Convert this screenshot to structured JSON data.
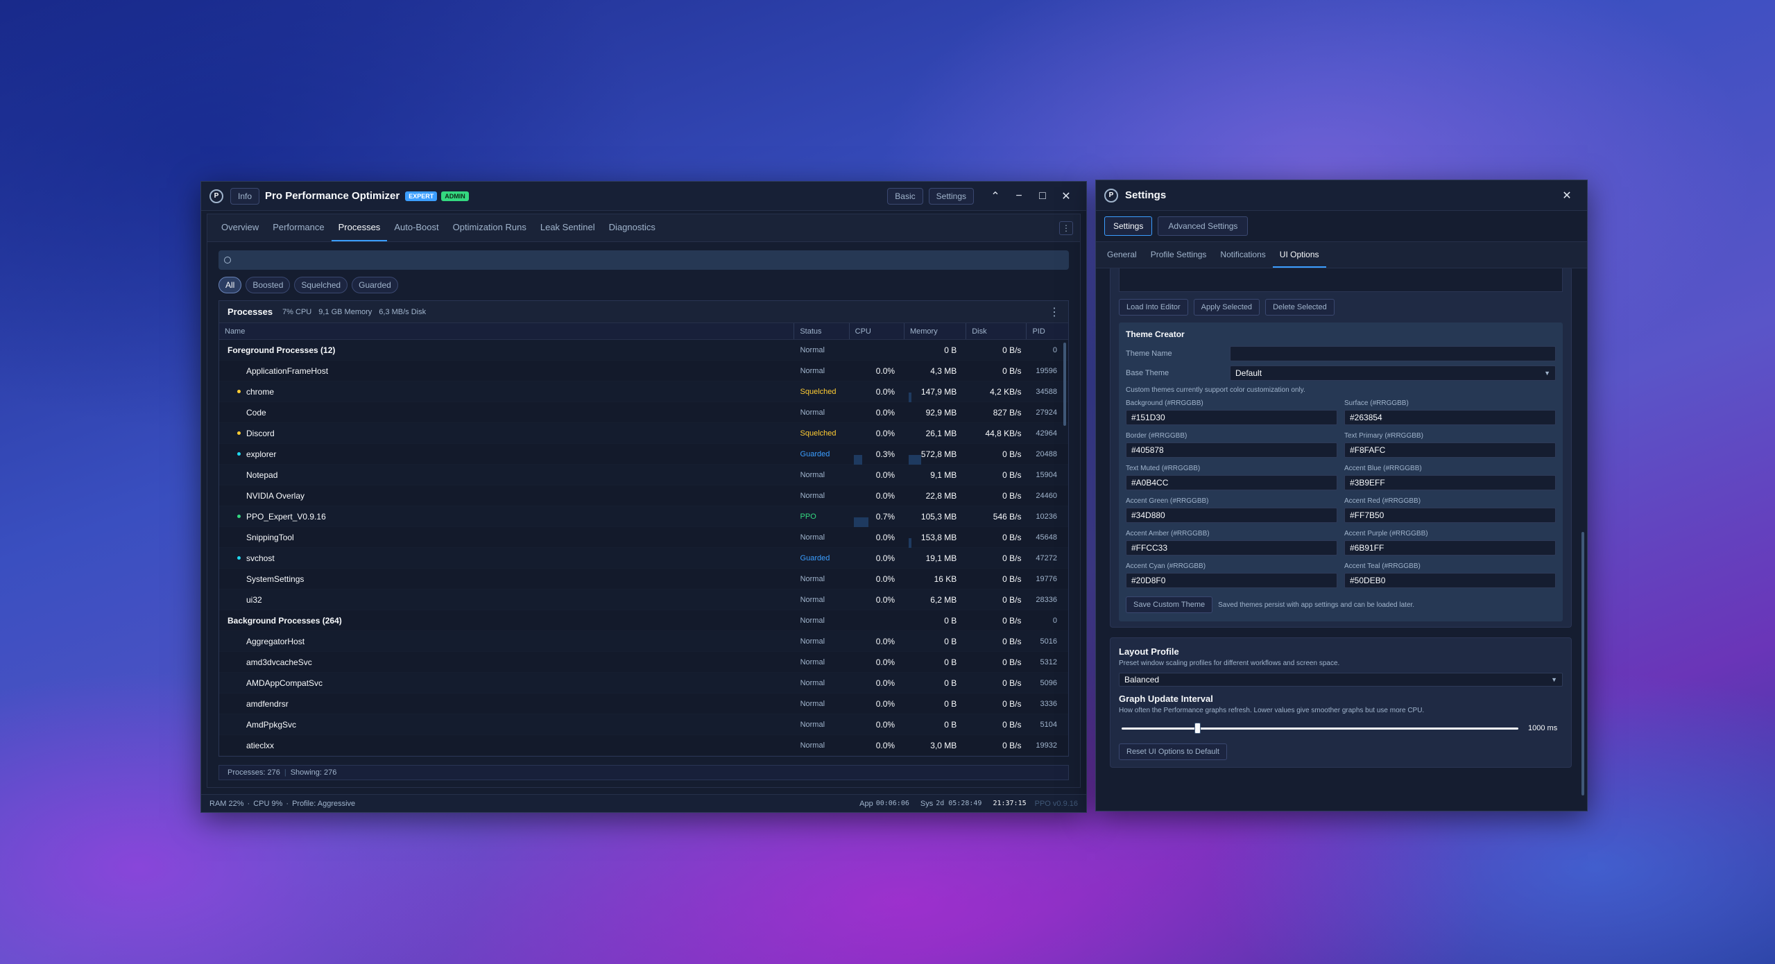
{
  "main": {
    "info_label": "Info",
    "title": "Pro Performance Optimizer",
    "badge_expert": "EXPERT",
    "badge_admin": "ADMIN",
    "basic_label": "Basic",
    "settings_label": "Settings",
    "tabs": [
      "Overview",
      "Performance",
      "Processes",
      "Auto-Boost",
      "Optimization Runs",
      "Leak Sentinel",
      "Diagnostics"
    ],
    "filters": [
      "All",
      "Boosted",
      "Squelched",
      "Guarded"
    ],
    "panel_title": "Processes",
    "stat_cpu": "7% CPU",
    "stat_mem": "9,1 GB Memory",
    "stat_disk": "6,3 MB/s Disk",
    "columns": [
      "Name",
      "Status",
      "CPU",
      "Memory",
      "Disk",
      "PID"
    ],
    "rows": [
      {
        "name": "Foreground Processes (12)",
        "status": "Normal",
        "cpu": "",
        "mem": "0 B",
        "disk": "0 B/s",
        "pid": "0",
        "group": true
      },
      {
        "name": "ApplicationFrameHost",
        "status": "Normal",
        "cpu": "0.0%",
        "mem": "4,3 MB",
        "disk": "0 B/s",
        "pid": "19596"
      },
      {
        "name": "chrome",
        "status": "Squelched",
        "cpu": "0.0%",
        "mem": "147,9 MB",
        "disk": "4,2 KB/s",
        "pid": "34588",
        "dot": "#FFCC33",
        "membar": 0.05
      },
      {
        "name": "Code",
        "status": "Normal",
        "cpu": "0.0%",
        "mem": "92,9 MB",
        "disk": "827 B/s",
        "pid": "27924"
      },
      {
        "name": "Discord",
        "status": "Squelched",
        "cpu": "0.0%",
        "mem": "26,1 MB",
        "disk": "44,8 KB/s",
        "pid": "42964",
        "dot": "#FFCC33"
      },
      {
        "name": "explorer",
        "status": "Guarded",
        "cpu": "0.3%",
        "mem": "572,8 MB",
        "disk": "0 B/s",
        "pid": "20488",
        "dot": "#20D8F0",
        "cpubar": 0.2,
        "membar": 0.25
      },
      {
        "name": "Notepad",
        "status": "Normal",
        "cpu": "0.0%",
        "mem": "9,1 MB",
        "disk": "0 B/s",
        "pid": "15904"
      },
      {
        "name": "NVIDIA Overlay",
        "status": "Normal",
        "cpu": "0.0%",
        "mem": "22,8 MB",
        "disk": "0 B/s",
        "pid": "24460"
      },
      {
        "name": "PPO_Expert_V0.9.16",
        "status": "PPO",
        "cpu": "0.7%",
        "mem": "105,3 MB",
        "disk": "546 B/s",
        "pid": "10236",
        "dot": "#34D880",
        "cpubar": 0.35
      },
      {
        "name": "SnippingTool",
        "status": "Normal",
        "cpu": "0.0%",
        "mem": "153,8 MB",
        "disk": "0 B/s",
        "pid": "45648",
        "membar": 0.05
      },
      {
        "name": "svchost",
        "status": "Guarded",
        "cpu": "0.0%",
        "mem": "19,1 MB",
        "disk": "0 B/s",
        "pid": "47272",
        "dot": "#20D8F0"
      },
      {
        "name": "SystemSettings",
        "status": "Normal",
        "cpu": "0.0%",
        "mem": "16 KB",
        "disk": "0 B/s",
        "pid": "19776"
      },
      {
        "name": "ui32",
        "status": "Normal",
        "cpu": "0.0%",
        "mem": "6,2 MB",
        "disk": "0 B/s",
        "pid": "28336"
      },
      {
        "name": "Background Processes (264)",
        "status": "Normal",
        "cpu": "",
        "mem": "0 B",
        "disk": "0 B/s",
        "pid": "0",
        "group": true
      },
      {
        "name": "AggregatorHost",
        "status": "Normal",
        "cpu": "0.0%",
        "mem": "0 B",
        "disk": "0 B/s",
        "pid": "5016"
      },
      {
        "name": "amd3dvcacheSvc",
        "status": "Normal",
        "cpu": "0.0%",
        "mem": "0 B",
        "disk": "0 B/s",
        "pid": "5312"
      },
      {
        "name": "AMDAppCompatSvc",
        "status": "Normal",
        "cpu": "0.0%",
        "mem": "0 B",
        "disk": "0 B/s",
        "pid": "5096"
      },
      {
        "name": "amdfendrsr",
        "status": "Normal",
        "cpu": "0.0%",
        "mem": "0 B",
        "disk": "0 B/s",
        "pid": "3336"
      },
      {
        "name": "AmdPpkgSvc",
        "status": "Normal",
        "cpu": "0.0%",
        "mem": "0 B",
        "disk": "0 B/s",
        "pid": "5104"
      },
      {
        "name": "atieclxx",
        "status": "Normal",
        "cpu": "0.0%",
        "mem": "3,0 MB",
        "disk": "0 B/s",
        "pid": "19932"
      }
    ],
    "footer_processes": "Processes: 276",
    "footer_showing": "Showing: 276",
    "status_ram": "RAM 22%",
    "status_cpu": "CPU 9%",
    "status_profile": "Profile: Aggressive",
    "app_label": "App",
    "app_time": "00:06:06",
    "sys_label": "Sys",
    "sys_time": "2d 05:28:49",
    "clock": "21:37:15",
    "version": "PPO v0.9.16"
  },
  "settings": {
    "title": "Settings",
    "top_tabs": [
      "Settings",
      "Advanced Settings"
    ],
    "sub_tabs": [
      "General",
      "Profile Settings",
      "Notifications",
      "UI Options"
    ],
    "load_btn": "Load Into Editor",
    "apply_btn": "Apply Selected",
    "delete_btn": "Delete Selected",
    "theme_creator": "Theme Creator",
    "theme_name_label": "Theme Name",
    "theme_name_value": "",
    "base_theme_label": "Base Theme",
    "base_theme_value": "Default",
    "custom_note": "Custom themes currently support color customization only.",
    "colors": [
      {
        "label": "Background (#RRGGBB)",
        "value": "#151D30"
      },
      {
        "label": "Surface (#RRGGBB)",
        "value": "#263854"
      },
      {
        "label": "Border (#RRGGBB)",
        "value": "#405878"
      },
      {
        "label": "Text Primary (#RRGGBB)",
        "value": "#F8FAFC"
      },
      {
        "label": "Text Muted (#RRGGBB)",
        "value": "#A0B4CC"
      },
      {
        "label": "Accent Blue (#RRGGBB)",
        "value": "#3B9EFF"
      },
      {
        "label": "Accent Green (#RRGGBB)",
        "value": "#34D880"
      },
      {
        "label": "Accent Red (#RRGGBB)",
        "value": "#FF7B50"
      },
      {
        "label": "Accent Amber (#RRGGBB)",
        "value": "#FFCC33"
      },
      {
        "label": "Accent Purple (#RRGGBB)",
        "value": "#6B91FF"
      },
      {
        "label": "Accent Cyan (#RRGGBB)",
        "value": "#20D8F0"
      },
      {
        "label": "Accent Teal (#RRGGBB)",
        "value": "#50DEB0"
      }
    ],
    "save_theme_btn": "Save Custom Theme",
    "save_note": "Saved themes persist with app settings and can be loaded later.",
    "layout_title": "Layout Profile",
    "layout_desc": "Preset window scaling profiles for different workflows and screen space.",
    "layout_value": "Balanced",
    "graph_title": "Graph Update Interval",
    "graph_desc": "How often the Performance graphs refresh. Lower values give smoother graphs but use more CPU.",
    "graph_value": "1000 ms",
    "graph_fraction": 0.19,
    "reset_btn": "Reset UI Options to Default"
  },
  "colors": {
    "accent_blue": "#3B9EFF",
    "accent_green": "#34D880",
    "accent_amber": "#FFCC33",
    "accent_cyan": "#20D8F0"
  }
}
